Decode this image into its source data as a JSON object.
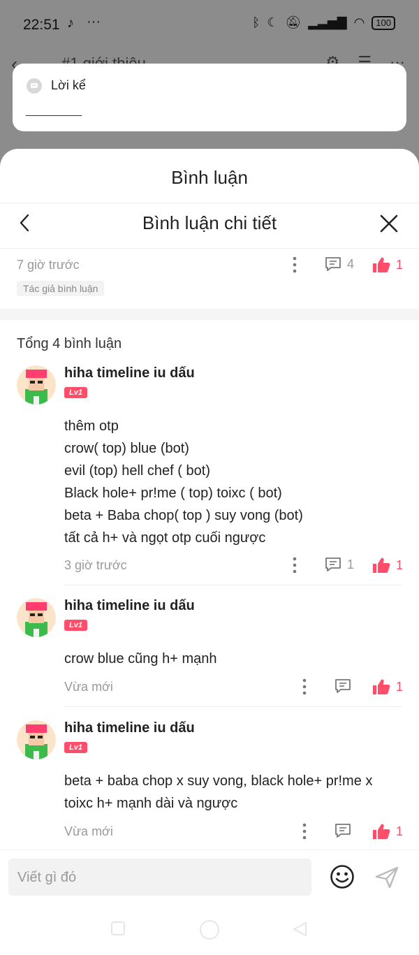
{
  "status": {
    "time": "22:51",
    "battery": "100",
    "extra": "···"
  },
  "behind": {
    "title": "#1 giới thiệu"
  },
  "narration": {
    "label": "Lời kể",
    "line": "__________"
  },
  "sheet": {
    "title": "Bình luận",
    "detail_title": "Bình luận chi tiết"
  },
  "parent": {
    "time": "7 giờ trước",
    "replies": "4",
    "likes": "1",
    "tag": "Tác giả bình luận"
  },
  "total_label": "Tổng 4 bình luận",
  "comments": [
    {
      "user": "hiha timeline iu dấu",
      "level": "Lv1",
      "lines": [
        "thêm otp",
        "crow( top) blue (bot)",
        "evil (top) hell chef ( bot)",
        "Black hole+ pr!me ( top) toixc ( bot)",
        "beta + Baba chop( top ) suy vong (bot)",
        "tất cả h+ và ngọt otp cuối ngược"
      ],
      "time": "3 giờ trước",
      "replies": "1",
      "likes": "1"
    },
    {
      "user": "hiha timeline iu dấu",
      "level": "Lv1",
      "lines": [
        "crow blue cũng h+ mạnh"
      ],
      "time": "Vừa mới",
      "replies": "",
      "likes": "1"
    },
    {
      "user": "hiha timeline iu dấu",
      "level": "Lv1",
      "lines": [
        "beta + baba chop  x suy vong, black hole+ pr!me x",
        "toixc h+ mạnh dài và ngược"
      ],
      "time": "Vừa mới",
      "replies": "",
      "likes": "1"
    }
  ],
  "input": {
    "placeholder": "Viết gì đó"
  },
  "colors": {
    "accent": "#ff4d6a",
    "muted": "#999999",
    "overlay": "#8c8c8c"
  },
  "icons": [
    "tiktok-icon",
    "bluetooth-icon",
    "moon-icon",
    "mute-icon",
    "signal-icon",
    "wifi-icon",
    "battery-icon",
    "settings-icon",
    "list-icon",
    "more-icon",
    "chevron-left-icon",
    "close-icon",
    "kebab-icon",
    "comment-icon",
    "thumbs-up-icon",
    "emoji-icon",
    "send-icon"
  ]
}
